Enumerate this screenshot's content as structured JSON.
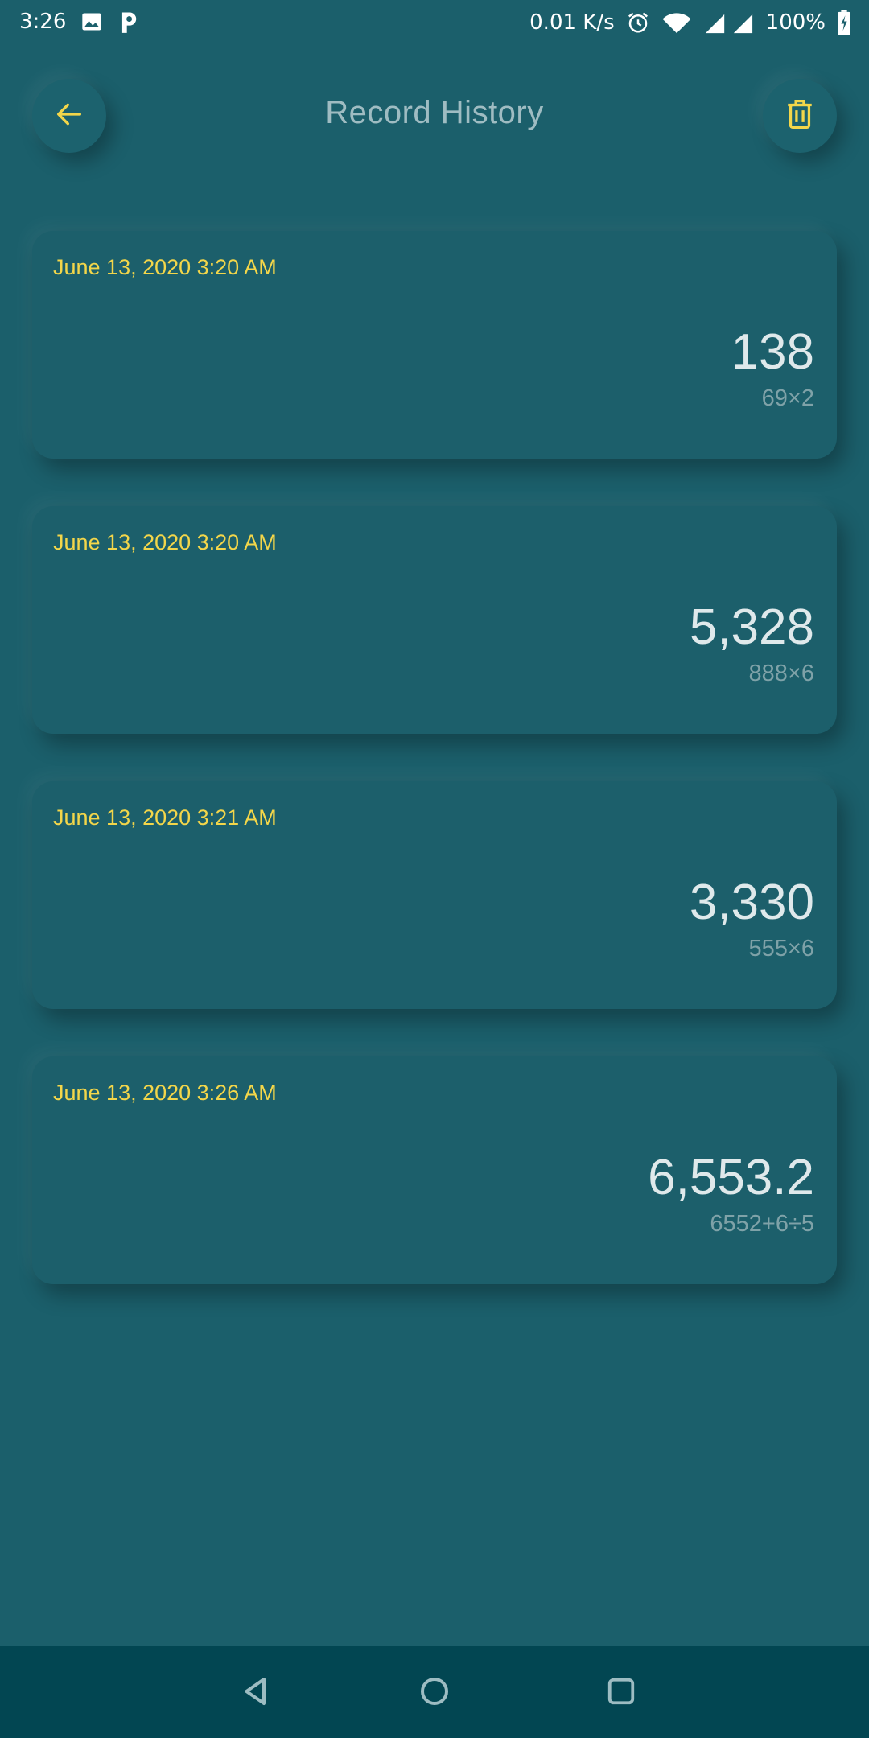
{
  "status_bar": {
    "time": "3:26",
    "net_speed": "0.01 K/s",
    "battery": "100%",
    "icons": [
      "image-icon",
      "parking-app-icon",
      "alarm-icon",
      "wifi-icon",
      "signal-icon",
      "battery-charging-icon"
    ]
  },
  "header": {
    "title": "Record History",
    "back_icon": "arrow-left-icon",
    "delete_icon": "trash-icon"
  },
  "records": [
    {
      "date": "June 13, 2020 3:20 AM",
      "result": "138",
      "expression": "69×2"
    },
    {
      "date": "June 13, 2020 3:20 AM",
      "result": "5,328",
      "expression": "888×6"
    },
    {
      "date": "June 13, 2020 3:21 AM",
      "result": "3,330",
      "expression": "555×6"
    },
    {
      "date": "June 13, 2020 3:26 AM",
      "result": "6,553.2",
      "expression": "6552+6÷5"
    }
  ],
  "colors": {
    "background": "#1b5f6b",
    "accent": "#f3d64a",
    "result_text": "#dfe9eb",
    "expression_text": "#7fa2a8",
    "nav_bar": "#024652"
  }
}
